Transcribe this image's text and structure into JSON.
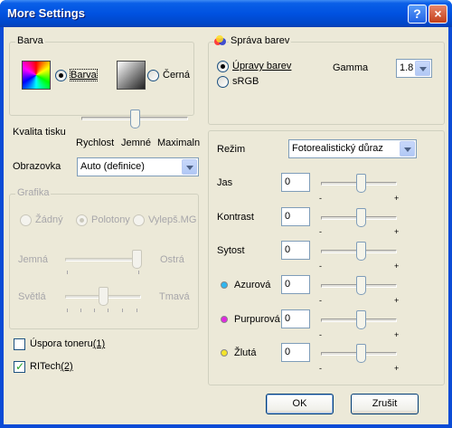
{
  "window": {
    "title": "More Settings",
    "help_glyph": "?",
    "close_glyph": "×"
  },
  "barva_group": {
    "label": "Barva",
    "color_option": "Barva",
    "black_option": "Černá"
  },
  "kvalita": {
    "label": "Kvalita tisku",
    "ticks": [
      "Rychlost",
      "Jemné",
      "Maximaln"
    ],
    "level": 0.5
  },
  "obrazovka": {
    "label": "Obrazovka",
    "value": "Auto (definice)"
  },
  "grafika": {
    "label": "Grafika",
    "options": [
      "Žádný",
      "Polotony",
      "Vylepš.MG"
    ],
    "jemna": "Jemná",
    "ostra": "Ostrá",
    "svetla": "Světlá",
    "tmava": "Tmavá"
  },
  "uspora": {
    "label": "Úspora toneru",
    "suffix": "(1)",
    "checked": false
  },
  "ritech": {
    "label": "RITech",
    "suffix": "(2)",
    "checked": true
  },
  "sprava": {
    "label": "Správa barev",
    "upravy": "Úpravy barev",
    "srgb": "sRGB",
    "gamma_label": "Gamma",
    "gamma_value": "1.8"
  },
  "rezim": {
    "label": "Režim",
    "value": "Fotorealistický důraz"
  },
  "adjust": [
    {
      "label": "Jas",
      "value": "0",
      "minus": "-",
      "plus": "+"
    },
    {
      "label": "Kontrast",
      "value": "0",
      "minus": "-",
      "plus": "+"
    },
    {
      "label": "Sytost",
      "value": "0",
      "minus": "-",
      "plus": "+"
    },
    {
      "label": "Azurová",
      "value": "0",
      "minus": "-",
      "plus": "+"
    },
    {
      "label": "Purpurová",
      "value": "0",
      "minus": "-",
      "plus": "+"
    },
    {
      "label": "Žlutá",
      "value": "0",
      "minus": "-",
      "plus": "+"
    }
  ],
  "colors": {
    "cyan": "#2fb6f0",
    "magenta": "#e028e0",
    "yellow": "#f4e42a"
  },
  "buttons": {
    "ok": "OK",
    "cancel": "Zrušit"
  }
}
